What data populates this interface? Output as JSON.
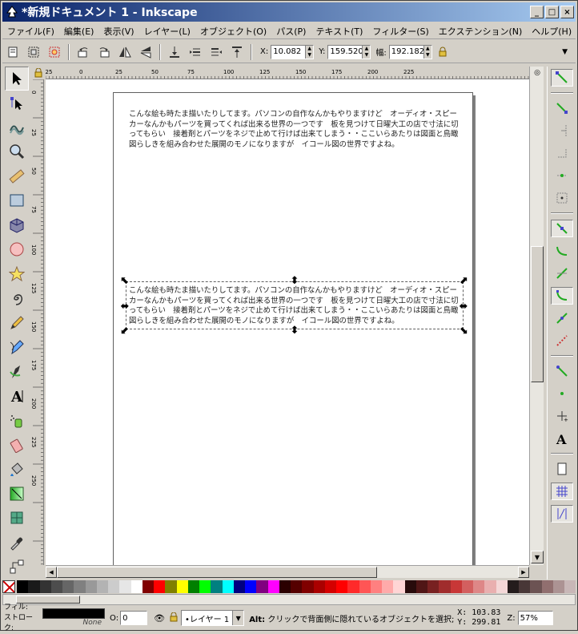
{
  "window": {
    "title": "*新規ドキュメント 1 - Inkscape",
    "minimize_label": "_",
    "maximize_label": "□",
    "close_label": "×"
  },
  "menubar": [
    "ファイル(F)",
    "編集(E)",
    "表示(V)",
    "レイヤー(L)",
    "オブジェクト(O)",
    "パス(P)",
    "テキスト(T)",
    "フィルター(S)",
    "エクステンション(N)",
    "ヘルプ(H)"
  ],
  "toolbar": {
    "x_label": "X:",
    "x_value": "10.082",
    "y_label": "Y:",
    "y_value": "159.520",
    "w_label": "幅:",
    "w_value": "192.182",
    "overflow": "▼"
  },
  "rulers": {
    "h_ticks": [
      "-25",
      "0",
      "25",
      "50",
      "75",
      "100",
      "125",
      "150",
      "175",
      "200",
      "225"
    ],
    "v_ticks": [
      "0",
      "25",
      "50",
      "75",
      "100",
      "125",
      "150",
      "175",
      "200",
      "225",
      "250"
    ]
  },
  "document": {
    "text1": "こんな絵も時たま描いたりしてます。パソコンの自作なんかもやりますけど　オーディオ・スピーカーなんかもパーツを買ってくれば出来る世界の一つです　板を見つけて日曜大工の店で寸法に切ってもらい　接着剤とパーツをネジで止めて行けば出来てしまう・・ここいらあたりは図面と鳥瞰図らしきを組み合わせた展開のモノになりますが　イコール図の世界ですよね。",
    "text2": "こんな絵も時たま描いたりしてます。パソコンの自作なんかもやりますけど　オーディオ・スピーカーなんかもパーツを買ってくれば出来る世界の一つです　板を見つけて日曜大工の店で寸法に切ってもらい　接着剤とパーツをネジで止めて行けば出来てしまう・・ここいらあたりは図面と鳥瞰図らしきを組み合わせた展開のモノになりますが　イコール図の世界ですよね。"
  },
  "palette_colors": [
    "#000000",
    "#1a1a1a",
    "#333333",
    "#4d4d4d",
    "#666666",
    "#808080",
    "#999999",
    "#b3b3b3",
    "#cccccc",
    "#e6e6e6",
    "#ffffff",
    "#800000",
    "#ff0000",
    "#808000",
    "#ffff00",
    "#008000",
    "#00ff00",
    "#008080",
    "#00ffff",
    "#000080",
    "#0000ff",
    "#800080",
    "#ff00ff",
    "#2b0000",
    "#550000",
    "#800000",
    "#aa0000",
    "#d40000",
    "#ff0000",
    "#ff2a2a",
    "#ff5555",
    "#ff8080",
    "#ffaaaa",
    "#ffd5d5",
    "#280b0b",
    "#501616",
    "#782121",
    "#a02c2c",
    "#c83737",
    "#d35f5f",
    "#de8787",
    "#e9afaf",
    "#f4d7d7",
    "#241c1c",
    "#483737",
    "#6c5353",
    "#916f6f",
    "#ac9393",
    "#c8b7b7"
  ],
  "statusbar": {
    "fill_label": "フィル:",
    "stroke_label": "ストローク:",
    "stroke_value": "None",
    "opacity_label": "O:",
    "opacity_value": "0",
    "layer_value": "•レイヤー 1",
    "message_key": "Alt:",
    "message": " クリックで背面側に隠れているオブジェクトを選択;",
    "x_label": "X:",
    "x_value": "103.83",
    "y_label": "Y:",
    "y_value": "299.81",
    "zoom_label": "Z:",
    "zoom_value": "57%"
  }
}
